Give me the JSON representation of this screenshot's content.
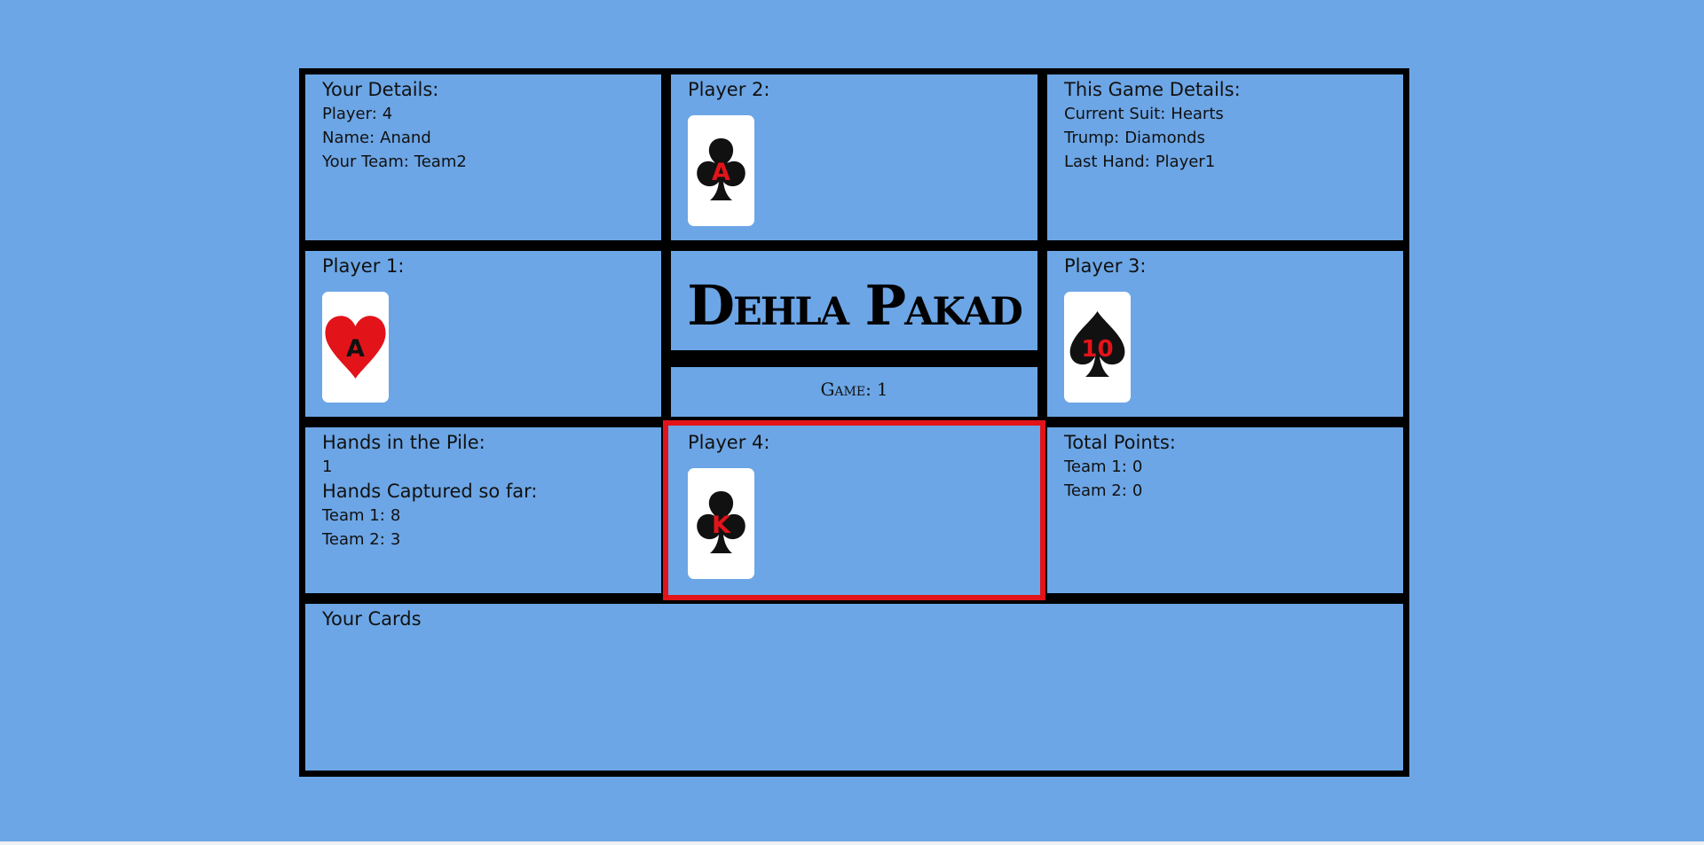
{
  "your_details": {
    "heading": "Your Details:",
    "player_label": "Player:",
    "player_value": "4",
    "name_label": "Name:",
    "name_value": "Anand",
    "team_label": "Your Team:",
    "team_value": "Team2"
  },
  "player2": {
    "label": "Player 2:",
    "card": {
      "rank": "A",
      "suit": "clubs",
      "rank_color": "#e2141a"
    }
  },
  "game_details": {
    "heading": "This Game Details:",
    "suit_label": "Current Suit:",
    "suit_value": "Hearts",
    "trump_label": "Trump:",
    "trump_value": "Diamonds",
    "last_hand_label": "Last Hand:",
    "last_hand_value": "Player1"
  },
  "player1": {
    "label": "Player 1:",
    "card": {
      "rank": "A",
      "suit": "hearts",
      "rank_color": "#111111"
    }
  },
  "title": "Dehla Pakad",
  "game": {
    "label": "Game:",
    "value": "1"
  },
  "player3": {
    "label": "Player 3:",
    "card": {
      "rank": "10",
      "suit": "spades",
      "rank_color": "#e2141a"
    }
  },
  "pile": {
    "heading": "Hands in the Pile:",
    "count": "1",
    "captured_heading": "Hands Captured so far:",
    "team1_label": "Team 1:",
    "team1_value": "8",
    "team2_label": "Team 2:",
    "team2_value": "3"
  },
  "player4": {
    "label": "Player 4:",
    "active": true,
    "card": {
      "rank": "K",
      "suit": "clubs",
      "rank_color": "#e2141a"
    }
  },
  "points": {
    "heading": "Total Points:",
    "team1_label": "Team 1:",
    "team1_value": "0",
    "team2_label": "Team 2:",
    "team2_value": "0"
  },
  "your_cards": {
    "heading": "Your Cards"
  },
  "colors": {
    "background": "#6ca6e6",
    "border": "#000000",
    "active_border": "#e2141a",
    "card_red": "#e2141a",
    "card_black": "#111111"
  }
}
